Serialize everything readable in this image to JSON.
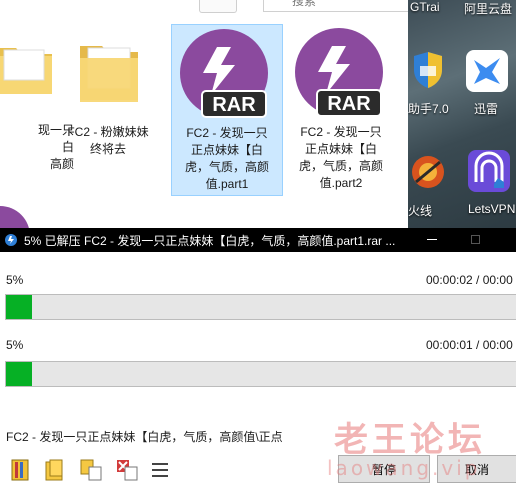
{
  "explorer": {
    "search_placeholder": "搜索",
    "files": [
      {
        "name_lines": [
          "现一只",
          "白",
          "高颜"
        ],
        "type": "folder-partial"
      },
      {
        "name_lines": [
          "FC2 - 粉嫩妹妹",
          "终将去"
        ],
        "type": "folder"
      },
      {
        "name_lines": [
          "FC2 - 发现一只",
          "正点妹妹【白",
          "虎，气质，高颜",
          "值.part1"
        ],
        "type": "rar",
        "selected": true
      },
      {
        "name_lines": [
          "FC2 - 发现一只",
          "正点妹妹【白",
          "虎，气质，高颜",
          "值.part2"
        ],
        "type": "rar"
      }
    ],
    "rar_badge": "RAR"
  },
  "desktop": {
    "top_labels": [
      "GTrai",
      "阿里云盘"
    ],
    "icons": [
      {
        "label": "助手7.0",
        "name": "helper-icon"
      },
      {
        "label": "迅雷",
        "name": "xunlei-icon"
      },
      {
        "label": "火线",
        "name": "crossfire-icon"
      },
      {
        "label": "LetsVPN",
        "name": "letsvpn-icon"
      }
    ]
  },
  "winrar": {
    "title": "5% 已解压 FC2 - 发现一只正点妹妹【白虎，气质，高颜值.part1.rar ...",
    "file_percent": "5%",
    "file_time": "00:00:02 / 00:00",
    "file_progress": 0.05,
    "total_percent": "5%",
    "total_time": "00:00:01 / 00:00",
    "total_progress": 0.05,
    "current_file": "FC2 - 发现一只正点妹妹【白虎，气质，高颜值\\正点",
    "pause_label": "暂停",
    "cancel_label": "取消",
    "watermark": "老王论坛",
    "watermark_sub": "laowang.vip"
  },
  "colors": {
    "progress_fill": "#06b025",
    "selection": "#cce8ff",
    "rar_purple": "#8b4a9e",
    "titlebar": "#000000"
  }
}
